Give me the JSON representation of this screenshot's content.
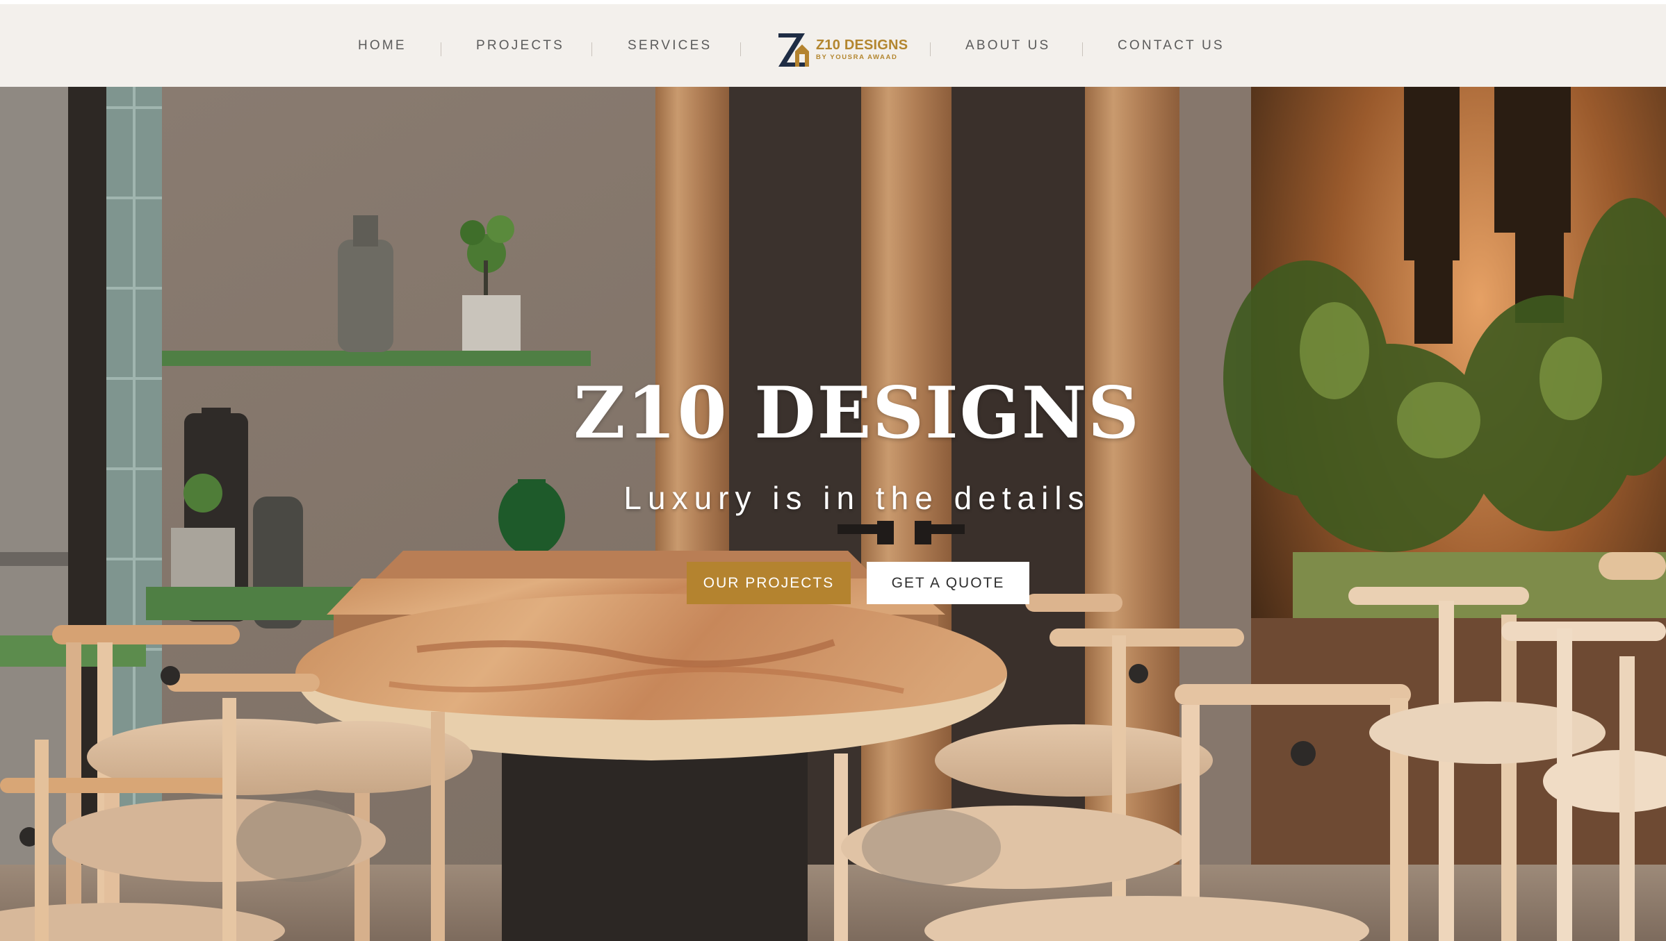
{
  "nav": {
    "items": [
      {
        "label": "HOME"
      },
      {
        "label": "PROJECTS"
      },
      {
        "label": "SERVICES"
      },
      {
        "label": "ABOUT US"
      },
      {
        "label": "CONTACT US"
      }
    ],
    "logo": {
      "title": "Z10 DESIGNS",
      "subtitle": "BY YOUSRA AWAAD",
      "icon": "z10-monogram-logo"
    }
  },
  "hero": {
    "title": "Z10 DESIGNS",
    "tagline": "Luxury is in the details",
    "buttons": {
      "primary": "OUR PROJECTS",
      "secondary": "GET A QUOTE"
    },
    "background": "restaurant interior photo"
  },
  "colors": {
    "nav_bg": "#f3f0ec",
    "accent_gold": "#b4832f",
    "logo_navy": "#1f2d45",
    "nav_text": "#5b5b5b"
  }
}
